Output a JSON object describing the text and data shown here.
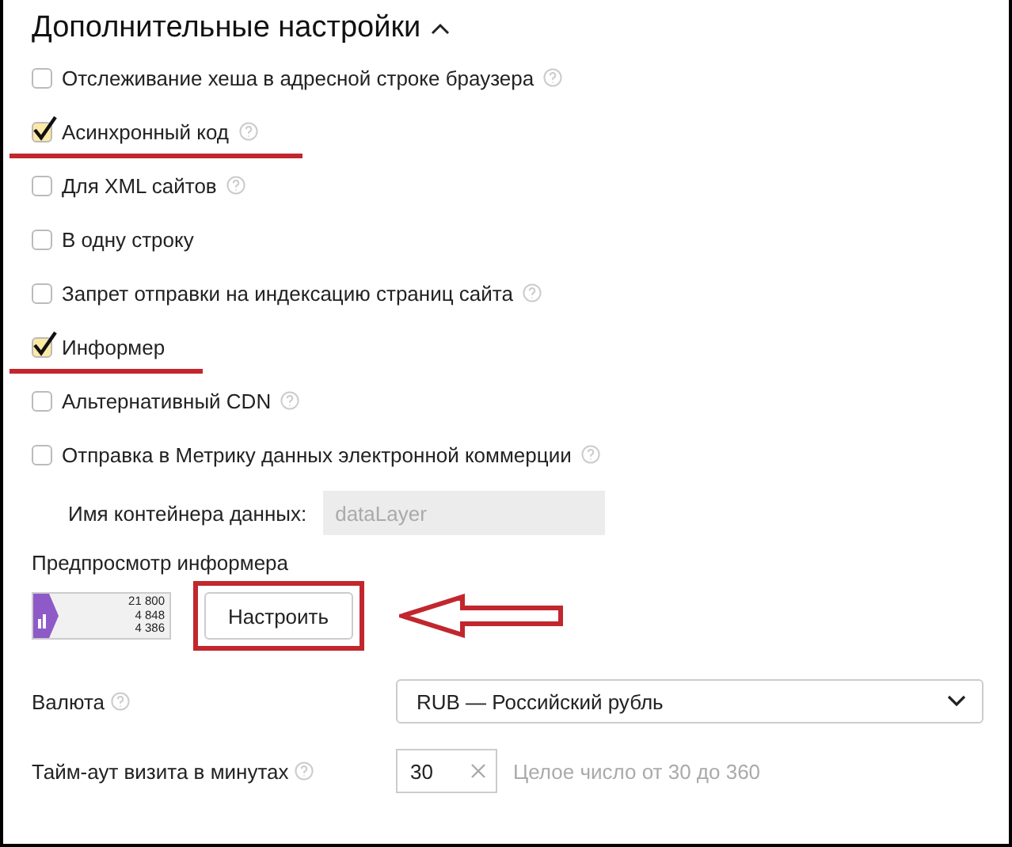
{
  "section": {
    "title": "Дополнительные настройки",
    "expanded": true
  },
  "options": [
    {
      "label": "Отслеживание хеша в адресной строке браузера",
      "checked": false,
      "help": true,
      "underlined": false
    },
    {
      "label": "Асинхронный код",
      "checked": true,
      "help": true,
      "underlined": true
    },
    {
      "label": "Для XML сайтов",
      "checked": false,
      "help": true,
      "underlined": false
    },
    {
      "label": "В одну строку",
      "checked": false,
      "help": false,
      "underlined": false
    },
    {
      "label": "Запрет отправки на индексацию страниц сайта",
      "checked": false,
      "help": true,
      "underlined": false
    },
    {
      "label": "Информер",
      "checked": true,
      "help": false,
      "underlined": true
    },
    {
      "label": "Альтернативный CDN",
      "checked": false,
      "help": true,
      "underlined": false
    },
    {
      "label": "Отправка в Метрику данных электронной коммерции",
      "checked": false,
      "help": true,
      "underlined": false
    }
  ],
  "container_field": {
    "label": "Имя контейнера данных:",
    "placeholder": "dataLayer",
    "disabled": true
  },
  "preview": {
    "label": "Предпросмотр информера",
    "informer": [
      "21 800",
      "4 848",
      "4 386"
    ],
    "button": "Настроить",
    "highlighted": true
  },
  "currency": {
    "label": "Валюта",
    "value": "RUB — Российский рубль"
  },
  "timeout": {
    "label": "Тайм-аут визита в минутах",
    "value": "30",
    "hint": "Целое число от 30 до 360"
  }
}
